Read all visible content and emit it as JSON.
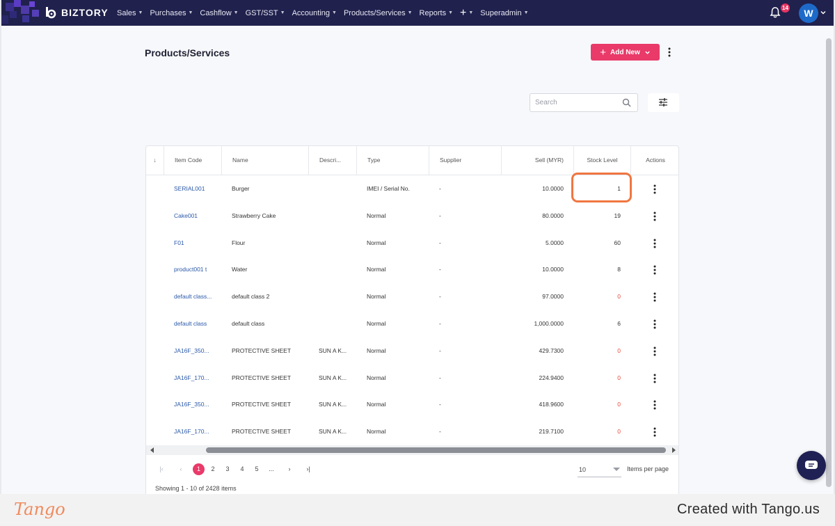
{
  "brand": {
    "name": "BIZTORY"
  },
  "nav": {
    "items": [
      {
        "label": "Sales"
      },
      {
        "label": "Purchases"
      },
      {
        "label": "Cashflow"
      },
      {
        "label": "GST/SST"
      },
      {
        "label": "Accounting"
      },
      {
        "label": "Products/Services"
      },
      {
        "label": "Reports"
      }
    ],
    "superadmin_label": "Superadmin",
    "notification_count": "14",
    "avatar_initial": "W"
  },
  "page": {
    "title": "Products/Services",
    "add_button_label": "Add New",
    "search_placeholder": "Search"
  },
  "table": {
    "sort_indicator": "↓",
    "columns": [
      "Item Code",
      "Name",
      "Descri...",
      "Type",
      "Supplier",
      "Sell (MYR)",
      "Stock Level",
      "Actions"
    ],
    "rows": [
      {
        "code": "SERIAL001",
        "name": "Burger",
        "desc": "",
        "type": "IMEI / Serial No.",
        "supplier": "-",
        "sell": "10.0000",
        "stock": "1",
        "stock_red": false
      },
      {
        "code": "Cake001",
        "name": "Strawberry Cake",
        "desc": "",
        "type": "Normal",
        "supplier": "-",
        "sell": "80.0000",
        "stock": "19",
        "stock_red": false
      },
      {
        "code": "F01",
        "name": "Flour",
        "desc": "",
        "type": "Normal",
        "supplier": "-",
        "sell": "5.0000",
        "stock": "60",
        "stock_red": false
      },
      {
        "code": "product001 t",
        "name": "Water",
        "desc": "",
        "type": "Normal",
        "supplier": "-",
        "sell": "10.0000",
        "stock": "8",
        "stock_red": false
      },
      {
        "code": "default class...",
        "name": "default class 2",
        "desc": "",
        "type": "Normal",
        "supplier": "-",
        "sell": "97.0000",
        "stock": "0",
        "stock_red": true
      },
      {
        "code": "default class",
        "name": "default class",
        "desc": "",
        "type": "Normal",
        "supplier": "-",
        "sell": "1,000.0000",
        "stock": "6",
        "stock_red": false
      },
      {
        "code": "JA16F_350...",
        "name": "PROTECTIVE SHEET",
        "desc": "SUN A K...",
        "type": "Normal",
        "supplier": "-",
        "sell": "429.7300",
        "stock": "0",
        "stock_red": true
      },
      {
        "code": "JA16F_170...",
        "name": "PROTECTIVE SHEET",
        "desc": "SUN A K...",
        "type": "Normal",
        "supplier": "-",
        "sell": "224.9400",
        "stock": "0",
        "stock_red": true
      },
      {
        "code": "JA16F_350...",
        "name": "PROTECTIVE SHEET",
        "desc": "SUN A K...",
        "type": "Normal",
        "supplier": "-",
        "sell": "418.9600",
        "stock": "0",
        "stock_red": true
      },
      {
        "code": "JA16F_170...",
        "name": "PROTECTIVE SHEET",
        "desc": "SUN A K...",
        "type": "Normal",
        "supplier": "-",
        "sell": "219.7100",
        "stock": "0",
        "stock_red": true
      }
    ]
  },
  "pagination": {
    "pages": [
      "1",
      "2",
      "3",
      "4",
      "5",
      "..."
    ],
    "current_page": "1",
    "per_page_value": "10",
    "per_page_label": "Items per page",
    "showing_text": "Showing 1 - 10 of 2428 items"
  },
  "footer": {
    "logo_text": "Tango",
    "credit_text": "Created with Tango.us"
  },
  "colors": {
    "nav_bg": "#20214d",
    "accent": "#e93a6a",
    "link": "#2a58a8",
    "stock_zero": "#e54b3a",
    "highlight": "#f07640"
  }
}
